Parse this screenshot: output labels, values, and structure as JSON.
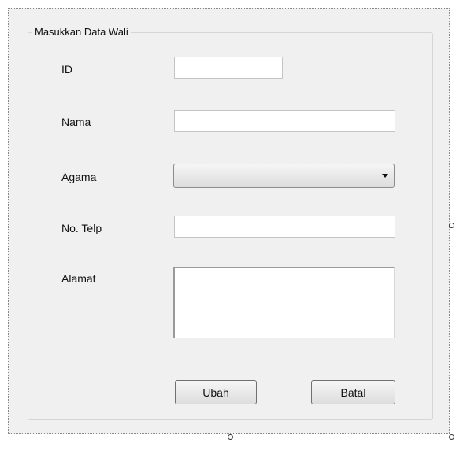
{
  "form": {
    "group_title": "Masukkan Data Wali",
    "fields": {
      "id": {
        "label": "ID",
        "value": ""
      },
      "nama": {
        "label": "Nama",
        "value": ""
      },
      "agama": {
        "label": "Agama",
        "value": ""
      },
      "telp": {
        "label": "No. Telp",
        "value": ""
      },
      "alamat": {
        "label": "Alamat",
        "value": ""
      }
    },
    "buttons": {
      "ubah": "Ubah",
      "batal": "Batal"
    }
  },
  "icons": {
    "dropdown": "chevron-down-icon",
    "resize_handle": "resize-handle-icon"
  },
  "colors": {
    "form_background": "#f0f0f0",
    "input_background": "#ffffff"
  }
}
